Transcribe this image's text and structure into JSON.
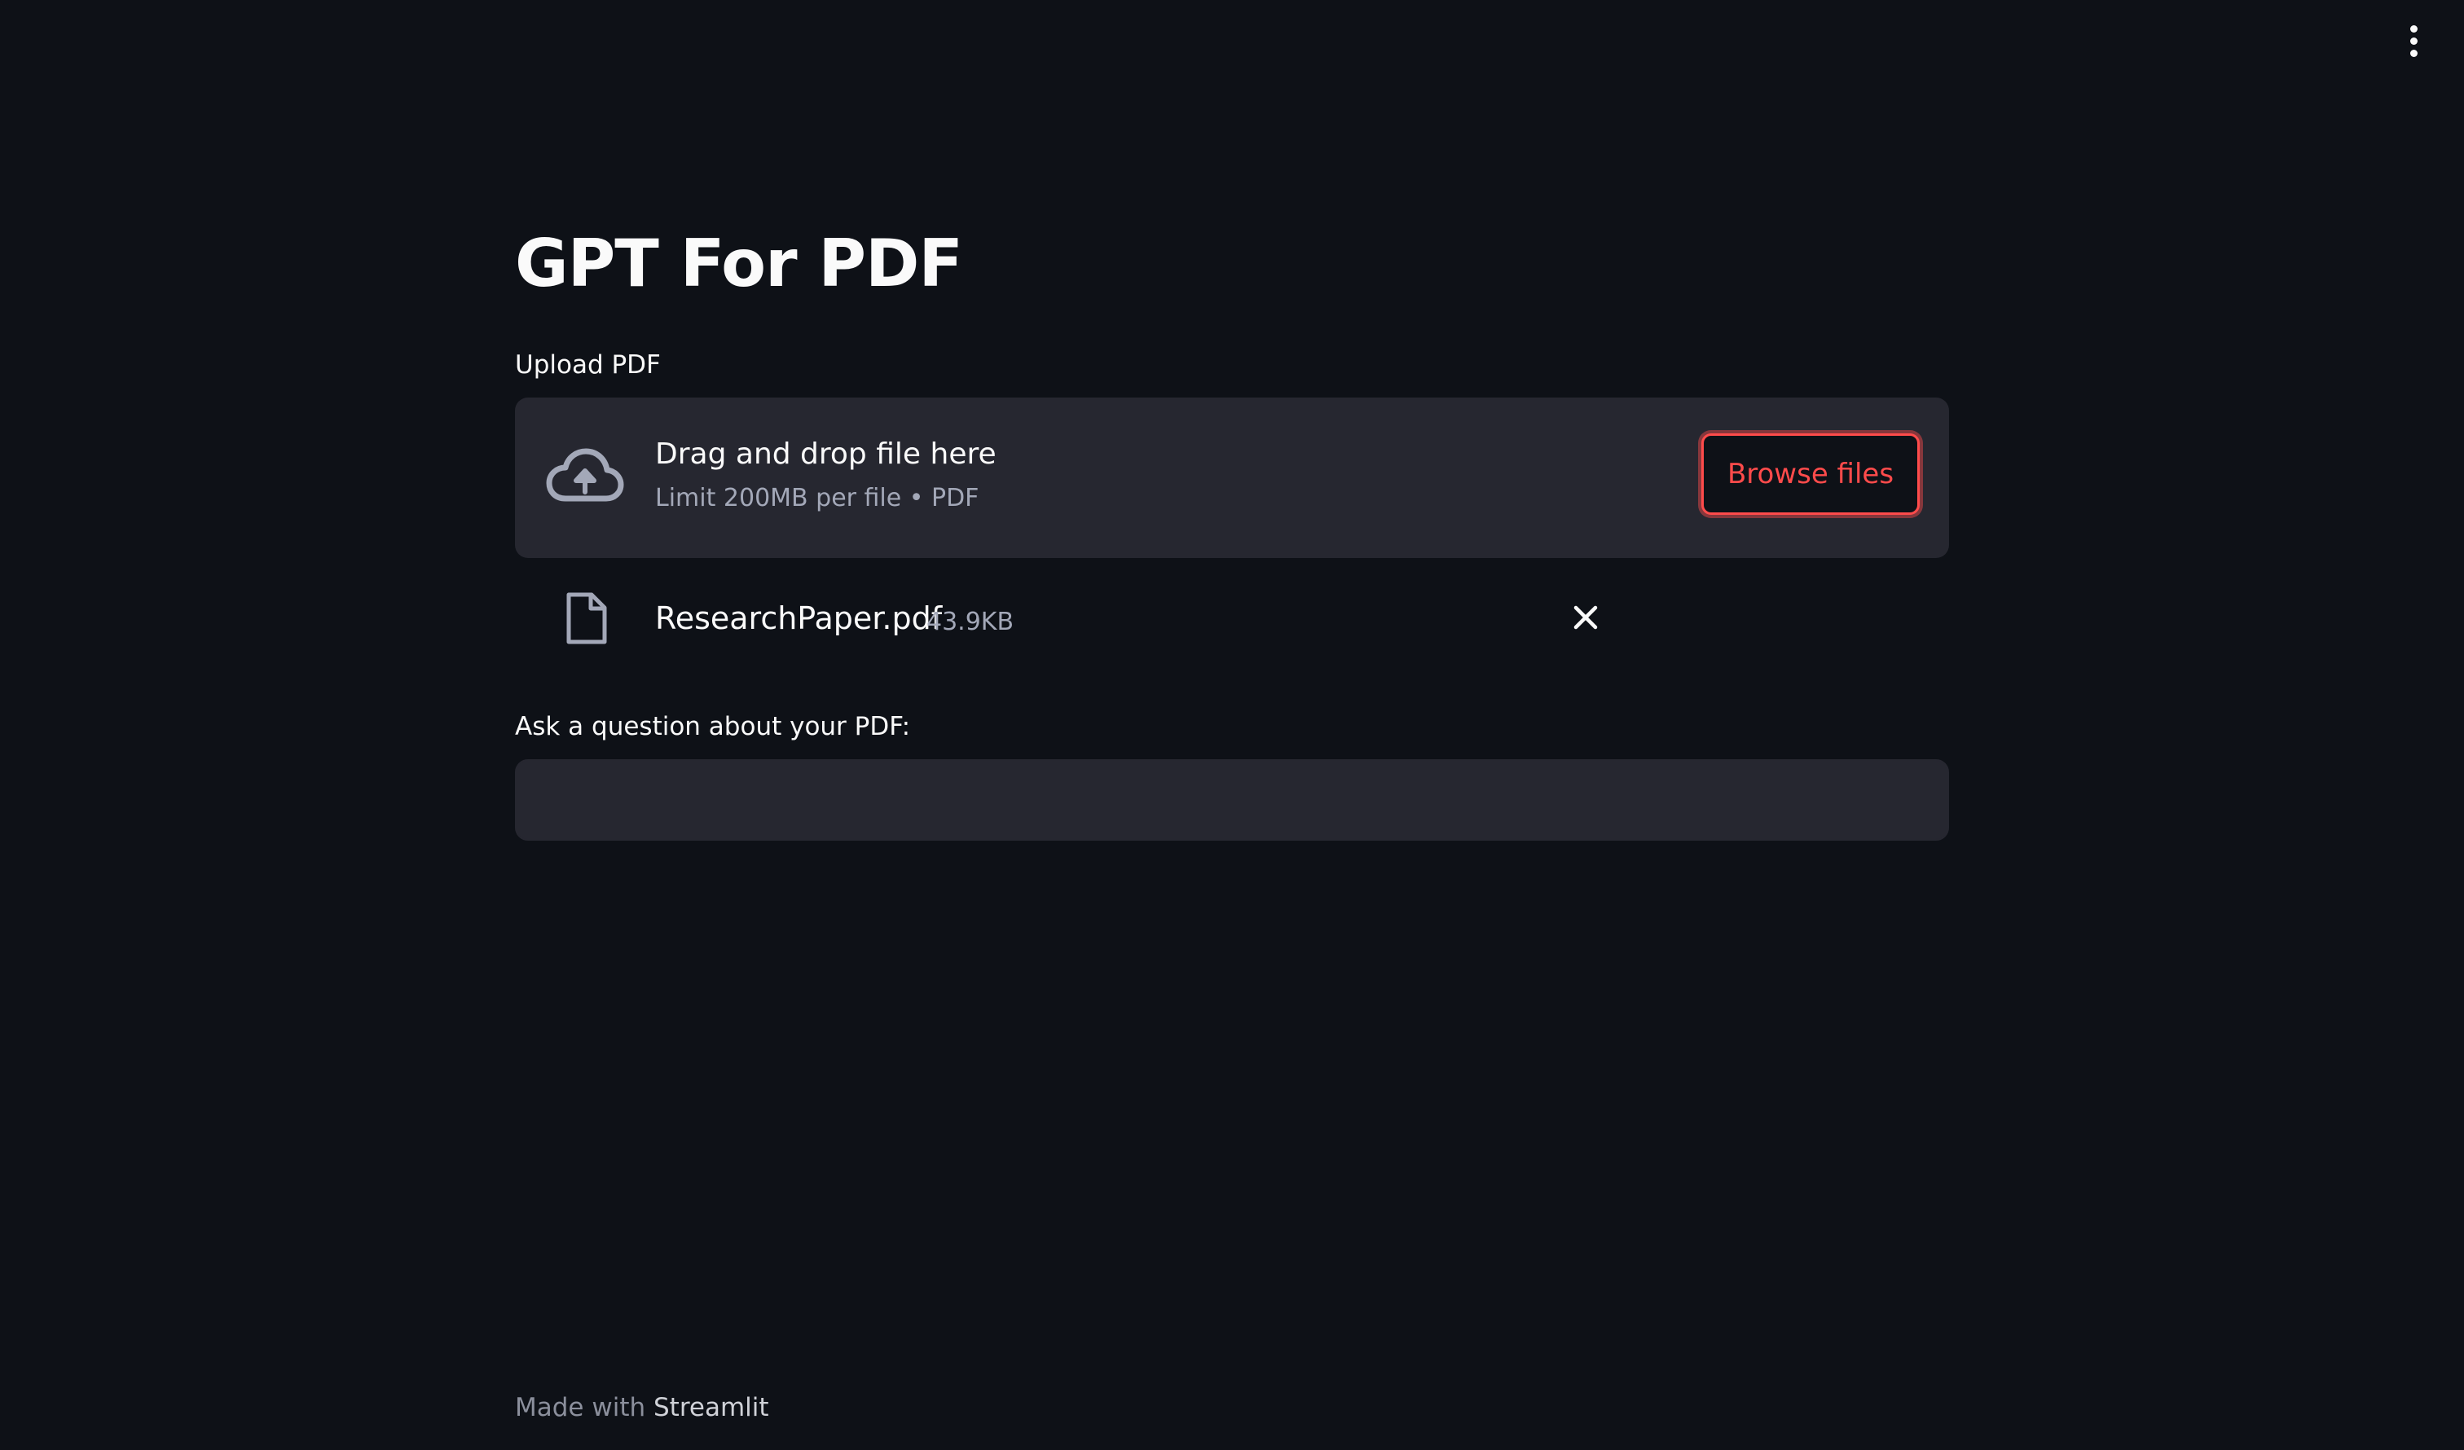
{
  "header": {
    "menu_icon": "vertical-ellipsis-icon"
  },
  "main": {
    "title": "GPT For PDF",
    "upload": {
      "label": "Upload PDF",
      "dropzone_icon": "cloud-upload-icon",
      "dropzone_main": "Drag and drop file here",
      "dropzone_sub": "Limit 200MB per file • PDF",
      "browse_label": "Browse files"
    },
    "uploaded_file": {
      "icon": "file-icon",
      "name": "ResearchPaper.pdf",
      "size": "43.9KB",
      "remove_icon": "close-icon"
    },
    "question": {
      "label": "Ask a question about your PDF:",
      "value": "",
      "placeholder": ""
    }
  },
  "footer": {
    "prefix": "Made with",
    "link": "Streamlit"
  },
  "colors": {
    "background": "#0e1117",
    "surface": "#262730",
    "accent": "#ff4b4b",
    "text": "#fafafa",
    "muted_text": "#a3a8b8"
  }
}
